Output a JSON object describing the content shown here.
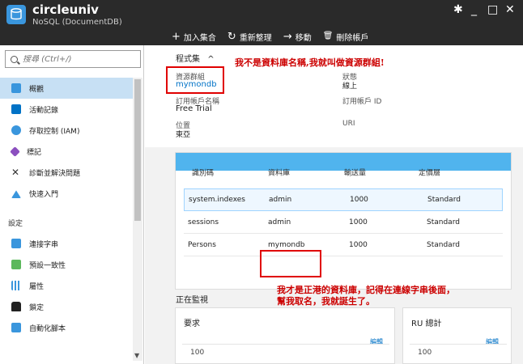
{
  "window": {
    "title": "circleuniv",
    "subtitle": "NoSQL (DocumentDB)",
    "controls": {
      "pin": "✱",
      "minimize": "_",
      "maximize": "□",
      "close": "✕"
    }
  },
  "toolbar": [
    {
      "icon": "plus-icon",
      "glyph": "+",
      "label": "加入集合"
    },
    {
      "icon": "refresh-icon",
      "glyph": "↻",
      "label": "重新整理"
    },
    {
      "icon": "arrow-right-icon",
      "glyph": "→",
      "label": "移動"
    },
    {
      "icon": "trash-icon",
      "glyph": "🗑",
      "label": "刪除帳戶"
    }
  ],
  "search": {
    "placeholder": "搜尋 (Ctrl+/)"
  },
  "sidebar": {
    "items": [
      {
        "label": "概觀",
        "icon": "overview-icon",
        "color": "#3a96dd",
        "active": true
      },
      {
        "label": "活動記錄",
        "icon": "activity-log-icon",
        "color": "#0072c6",
        "active": false
      },
      {
        "label": "存取控制 (IAM)",
        "icon": "iam-icon",
        "color": "#3a96dd",
        "active": false
      },
      {
        "label": "標記",
        "icon": "tag-icon",
        "color": "#8b4fbf",
        "active": false
      },
      {
        "label": "診斷並解決問題",
        "icon": "tools-icon",
        "color": "#333333",
        "active": false
      },
      {
        "label": "快速入門",
        "icon": "quickstart-icon",
        "color": "#3a96dd",
        "active": false
      }
    ],
    "section_label": "設定",
    "settings_items": [
      {
        "label": "連接字串",
        "icon": "connection-string-icon",
        "color": "#3a96dd"
      },
      {
        "label": "預設一致性",
        "icon": "consistency-icon",
        "color": "#5cb85c"
      },
      {
        "label": "屬性",
        "icon": "properties-icon",
        "color": "#3a96dd"
      },
      {
        "label": "鎖定",
        "icon": "lock-icon",
        "color": "#222222"
      },
      {
        "label": "自動化腳本",
        "icon": "automation-icon",
        "color": "#3a96dd"
      }
    ]
  },
  "essentials": {
    "header": "程式集",
    "chevron": "^",
    "resource_group_label": "資源群組",
    "resource_group_value": "mymondb",
    "status_label": "狀態",
    "status_value": "線上",
    "subscription_name_label": "訂用帳戶名稱",
    "subscription_name_value": "Free Trial",
    "subscription_id_label": "訂用帳戶 ID",
    "location_label": "位置",
    "location_value": "東亞",
    "uri_label": "URI"
  },
  "annotation_1": "我不是資料庫名稱,我就叫做資源群組!",
  "annotation_2_line1": "我才是正港的資料庫，記得在連線字串後面，",
  "annotation_2_line2": "幫我取名，我就誕生了。",
  "db_table": {
    "headers": [
      "識別碼",
      "資料庫",
      "輸送量",
      "定價層"
    ],
    "rows": [
      [
        "system.indexes",
        "admin",
        "1000",
        "Standard"
      ],
      [
        "sessions",
        "admin",
        "1000",
        "Standard"
      ],
      [
        "Persons",
        "mymondb",
        "1000",
        "Standard"
      ]
    ]
  },
  "monitoring": {
    "title": "正在監視",
    "cards": [
      {
        "title": "要求",
        "edit": "編輯",
        "value": "100"
      },
      {
        "title": "RU 總計",
        "edit": "編輯",
        "value": "100"
      }
    ]
  }
}
